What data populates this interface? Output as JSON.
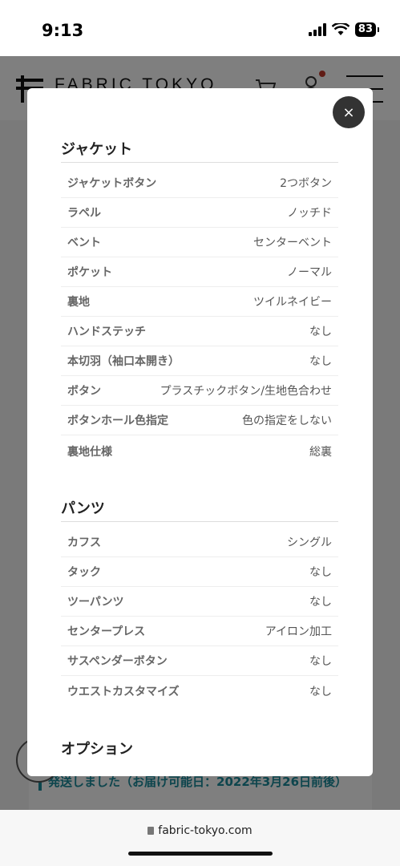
{
  "status": {
    "time": "9:13",
    "battery": "83"
  },
  "site": {
    "logo_text": "FABRIC TOKYO"
  },
  "background": {
    "shipping_text": "発送しました（お届け可能日：2022年3月26日前後）"
  },
  "modal": {
    "close_label": "×",
    "sections": [
      {
        "title": "ジャケット",
        "rows": [
          {
            "label": "ジャケットボタン",
            "value": "2つボタン"
          },
          {
            "label": "ラペル",
            "value": "ノッチド"
          },
          {
            "label": "ベント",
            "value": "センターベント"
          },
          {
            "label": "ポケット",
            "value": "ノーマル"
          },
          {
            "label": "裏地",
            "value": "ツイルネイビー"
          },
          {
            "label": "ハンドステッチ",
            "value": "なし"
          },
          {
            "label": "本切羽（袖口本開き）",
            "value": "なし"
          },
          {
            "label": "ボタン",
            "value": "プラスチックボタン/生地色合わせ"
          },
          {
            "label": "ボタンホール色指定",
            "value": "色の指定をしない"
          },
          {
            "label": "裏地仕様",
            "value": "総裏"
          }
        ]
      },
      {
        "title": "パンツ",
        "rows": [
          {
            "label": "カフス",
            "value": "シングル"
          },
          {
            "label": "タック",
            "value": "なし"
          },
          {
            "label": "ツーパンツ",
            "value": "なし"
          },
          {
            "label": "センタープレス",
            "value": "アイロン加工"
          },
          {
            "label": "サスペンダーボタン",
            "value": "なし"
          },
          {
            "label": "ウエストカスタマイズ",
            "value": "なし"
          }
        ]
      },
      {
        "title": "オプション",
        "rows": []
      }
    ]
  },
  "browser": {
    "url": "fabric-tokyo.com"
  }
}
